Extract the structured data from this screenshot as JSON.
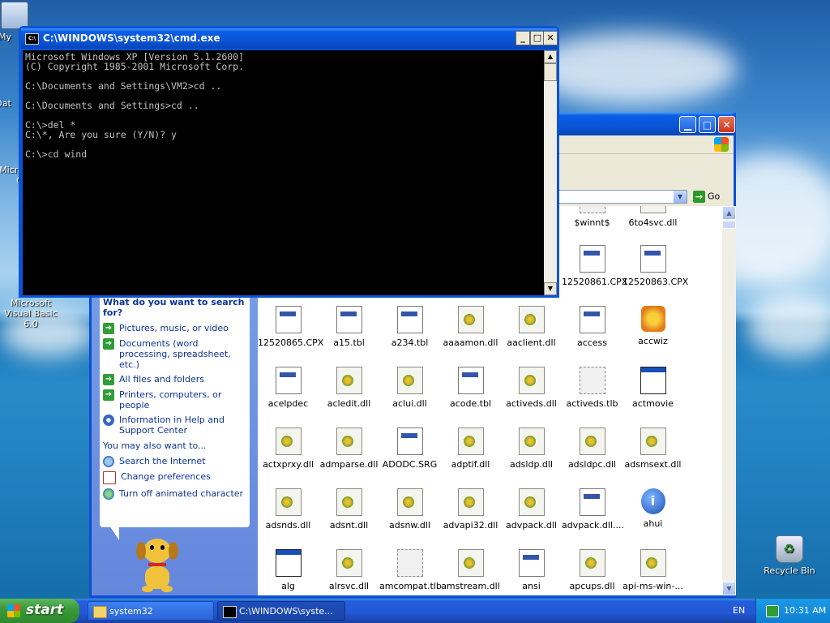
{
  "desktop": {
    "icons": [
      {
        "label": "My"
      },
      {
        "label": "Dat"
      },
      {
        "label": "Micro"
      },
      {
        "label": "C"
      },
      {
        "label": "Microsoft Visual Basic 6.0"
      },
      {
        "label": "Recycle Bin"
      }
    ]
  },
  "cmd": {
    "title": "C:\\WINDOWS\\system32\\cmd.exe",
    "icon_label": "C:\\",
    "lines": [
      "Microsoft Windows XP [Version 5.1.2600]",
      "(C) Copyright 1985-2001 Microsoft Corp.",
      "",
      "C:\\Documents and Settings\\VM2>cd ..",
      "",
      "C:\\Documents and Settings>cd ..",
      "",
      "C:\\>del *",
      "C:\\*, Are you sure (Y/N)? y",
      "",
      "C:\\>cd wind"
    ]
  },
  "explorer": {
    "address": {
      "go_label": "Go"
    },
    "search_panel": {
      "heading": "What do you want to search for?",
      "options": [
        {
          "label": "Pictures, music, or video"
        },
        {
          "label": "Documents (word processing, spreadsheet, etc.)"
        },
        {
          "label": "All files and folders"
        },
        {
          "label": "Printers, computers, or people"
        },
        {
          "label": "Information in Help and Support Center"
        }
      ],
      "also_heading": "You may also want to...",
      "also_options": [
        {
          "label": "Search the Internet"
        },
        {
          "label": "Change preferences"
        },
        {
          "label": "Turn off animated character"
        }
      ]
    },
    "files": [
      {
        "name": "$winnt$",
        "icon": "blank"
      },
      {
        "name": "6to4svc.dll",
        "icon": "dll"
      },
      {
        "name": "12520861.CPX",
        "icon": "doc"
      },
      {
        "name": "12520863.CPX",
        "icon": "doc"
      },
      {
        "name": "12520865.CPX",
        "icon": "doc"
      },
      {
        "name": "a15.tbl",
        "icon": "doc"
      },
      {
        "name": "a234.tbl",
        "icon": "doc"
      },
      {
        "name": "aaaamon.dll",
        "icon": "dll"
      },
      {
        "name": "aaclient.dll",
        "icon": "dll"
      },
      {
        "name": "access",
        "icon": "doc"
      },
      {
        "name": "accwiz",
        "icon": "wiz"
      },
      {
        "name": "acelpdec",
        "icon": "doc"
      },
      {
        "name": "acledit.dll",
        "icon": "dll"
      },
      {
        "name": "aclui.dll",
        "icon": "dll"
      },
      {
        "name": "acode.tbl",
        "icon": "doc"
      },
      {
        "name": "activeds.dll",
        "icon": "dll"
      },
      {
        "name": "activeds.tlb",
        "icon": "blank"
      },
      {
        "name": "actmovie",
        "icon": "win"
      },
      {
        "name": "actxprxy.dll",
        "icon": "dll"
      },
      {
        "name": "admparse.dll",
        "icon": "dll"
      },
      {
        "name": "ADODC.SRG",
        "icon": "doc"
      },
      {
        "name": "adptif.dll",
        "icon": "dll"
      },
      {
        "name": "adsldp.dll",
        "icon": "dll"
      },
      {
        "name": "adsldpc.dll",
        "icon": "dll"
      },
      {
        "name": "adsmsext.dll",
        "icon": "dll"
      },
      {
        "name": "adsnds.dll",
        "icon": "dll"
      },
      {
        "name": "adsnt.dll",
        "icon": "dll"
      },
      {
        "name": "adsnw.dll",
        "icon": "dll"
      },
      {
        "name": "advapi32.dll",
        "icon": "dll"
      },
      {
        "name": "advpack.dll",
        "icon": "dll"
      },
      {
        "name": "advpack.dll....",
        "icon": "doc"
      },
      {
        "name": "ahui",
        "icon": "info"
      },
      {
        "name": "alg",
        "icon": "win"
      },
      {
        "name": "alrsvc.dll",
        "icon": "dll"
      },
      {
        "name": "amcompat.tlb",
        "icon": "blank"
      },
      {
        "name": "amstream.dll",
        "icon": "dll"
      },
      {
        "name": "ansi",
        "icon": "doc"
      },
      {
        "name": "apcups.dll",
        "icon": "dll"
      },
      {
        "name": "api-ms-win-...",
        "icon": "dll"
      }
    ]
  },
  "taskbar": {
    "start_label": "start",
    "tasks": [
      {
        "label": "system32"
      },
      {
        "label": "C:\\WINDOWS\\syste..."
      }
    ],
    "language": "EN",
    "clock": "10:31 AM"
  }
}
